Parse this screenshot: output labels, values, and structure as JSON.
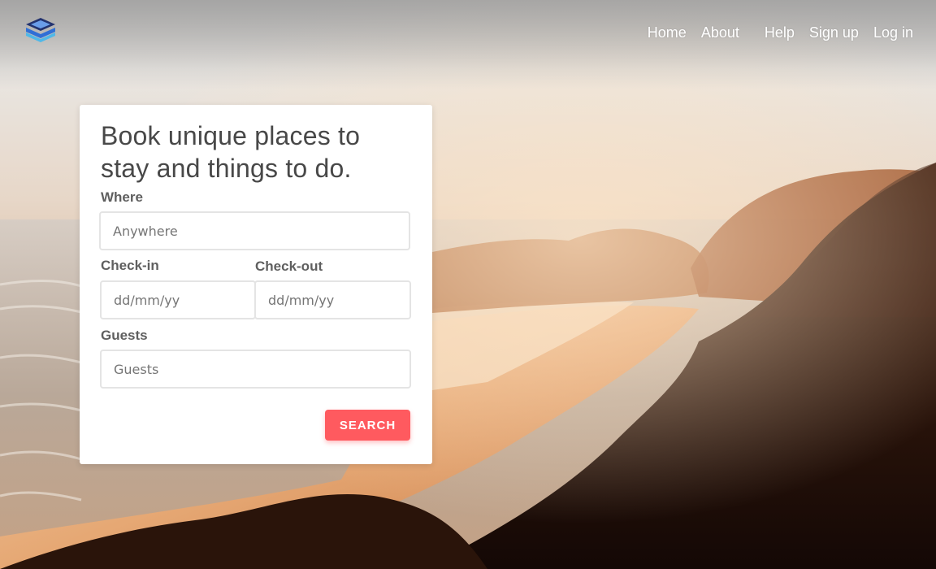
{
  "nav": {
    "logo_icon": "stacked-layers-logo",
    "links": [
      {
        "label": "Home"
      },
      {
        "label": "About"
      },
      {
        "label": "Help"
      },
      {
        "label": "Sign up"
      },
      {
        "label": "Log in"
      }
    ]
  },
  "booking": {
    "title": "Book unique places to stay and things to do.",
    "where": {
      "label": "Where",
      "placeholder": "Anywhere"
    },
    "checkin": {
      "label": "Check-in",
      "placeholder": "dd/mm/yy"
    },
    "checkout": {
      "label": "Check-out",
      "placeholder": "dd/mm/yy"
    },
    "guests": {
      "label": "Guests",
      "placeholder": "Guests"
    },
    "search_label": "SEARCH"
  },
  "colors": {
    "accent": "#ff5a5f",
    "card_bg": "#ffffff",
    "title_text": "#484848"
  }
}
